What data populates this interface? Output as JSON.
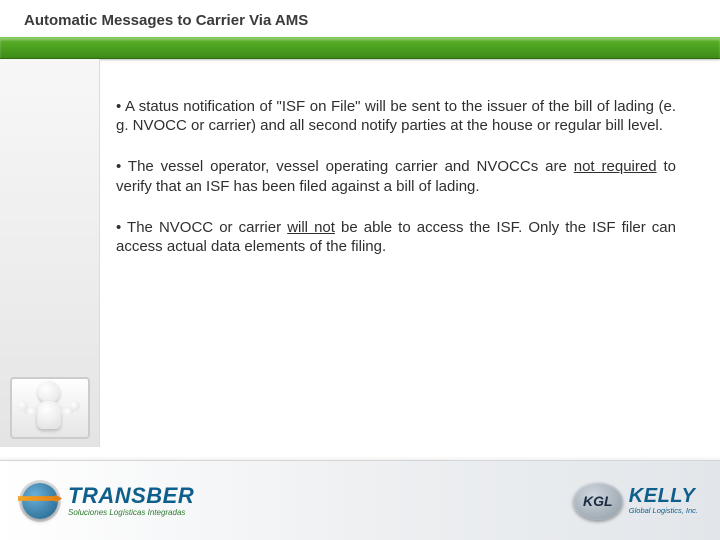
{
  "title": "Automatic Messages to Carrier Via AMS",
  "bullets": [
    {
      "pre": "• A status notification of \"ISF on File\" will be sent to the issuer of the bill of lading (e. g. NVOCC or carrier) and all second notify parties at the house or regular bill level.",
      "underline": "",
      "post": ""
    },
    {
      "pre": "• The vessel operator, vessel operating carrier and NVOCCs are ",
      "underline": "not required",
      "post": " to verify that an ISF has been filed against a bill of lading."
    },
    {
      "pre": "• The NVOCC or carrier ",
      "underline": "will not",
      "post": " be able to access the ISF. Only the ISF filer can access actual data elements of the filing."
    }
  ],
  "logos": {
    "transber": {
      "name": "TRANSBER",
      "tagline": "Soluciones Logísticas Integradas"
    },
    "kgl": {
      "badge": "KGL",
      "name": "KELLY",
      "tagline": "Global Logistics, Inc."
    }
  }
}
